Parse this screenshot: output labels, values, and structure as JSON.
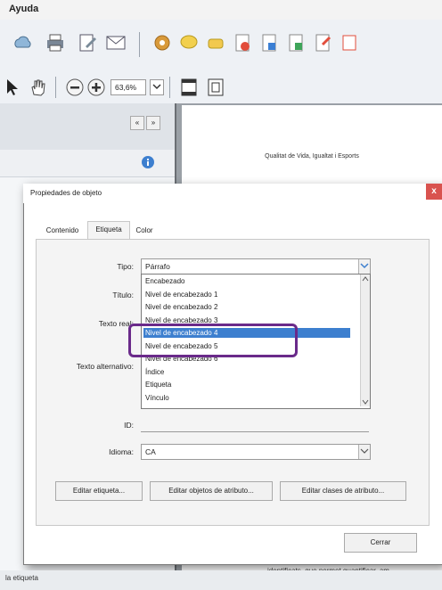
{
  "menubar": {
    "help_label": "Ayuda"
  },
  "toolbar": {
    "zoom_value": "63,6%",
    "icons": [
      "cloud-icon",
      "print-icon",
      "edit-icon",
      "email-icon",
      "settings-icon",
      "comment-icon",
      "stamp-icon",
      "pdf-icon",
      "pdf-export-icon",
      "pdf-share-icon",
      "form-icon",
      "sign-icon"
    ]
  },
  "nav": {
    "collapse_label": "«",
    "expand_label": "»"
  },
  "document": {
    "title": "Qualitat de Vida, Igualtat i Esports",
    "footer_text": "identificats, que permet quantificar, am"
  },
  "dialog": {
    "title": "Propiedades de objeto",
    "close_label": "x",
    "tabs": [
      "Contenido",
      "Etiqueta",
      "Color"
    ],
    "fields": {
      "tipo_label": "Tipo:",
      "tipo_value": "Párrafo",
      "titulo_label": "Título:",
      "texto_real_label": "Texto real:",
      "texto_alternativo_label": "Texto alternativo:",
      "id_label": "ID:",
      "idioma_label": "Idioma:",
      "idioma_value": "CA"
    },
    "list_items": [
      "Encabezado",
      "Nivel de encabezado 1",
      "Nivel de encabezado 2",
      "Nivel de encabezado 3",
      "Nivel de encabezado 4",
      "Nivel de encabezado 5",
      "Nivel de encabezado 6",
      "Índice",
      "Etiqueta",
      "Vínculo"
    ],
    "selected_index": 4,
    "buttons": {
      "edit_tag": "Editar etiqueta...",
      "edit_attr_objects": "Editar objetos de atributo...",
      "edit_attr_classes": "Editar clases de atributo...",
      "close": "Cerrar"
    }
  },
  "status": {
    "left_text": "la etiqueta"
  },
  "colors": {
    "selection": "#3d7fcf",
    "highlight": "#6a2a8a",
    "close": "#d9534f"
  }
}
